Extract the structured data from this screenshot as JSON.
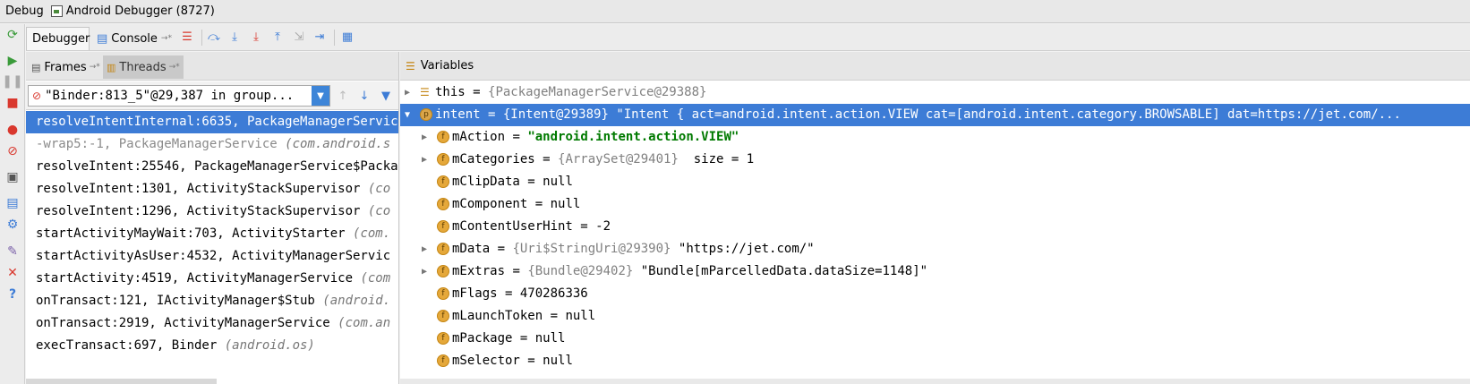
{
  "titlebar": {
    "label": "Debug",
    "session": "Android Debugger (8727)"
  },
  "tabs": {
    "debugger": "Debugger",
    "console": "Console",
    "console_pin": "→*"
  },
  "frames_panel": {
    "frames_tab": "Frames",
    "frames_pin": "→*",
    "threads_tab": "Threads",
    "threads_pin": "→*",
    "thread_selected": "\"Binder:813_5\"@29,387 in group...",
    "frames": [
      {
        "method": "resolveIntentInternal:6635, PackageManagerServic",
        "pkg": ""
      },
      {
        "method": "-wrap5:-1, PackageManagerService ",
        "pkg": "(com.android.s"
      },
      {
        "method": "resolveIntent:25546, PackageManagerService$Packa",
        "pkg": ""
      },
      {
        "method": "resolveIntent:1301, ActivityStackSupervisor ",
        "pkg": "(co"
      },
      {
        "method": "resolveIntent:1296, ActivityStackSupervisor ",
        "pkg": "(co"
      },
      {
        "method": "startActivityMayWait:703, ActivityStarter ",
        "pkg": "(com."
      },
      {
        "method": "startActivityAsUser:4532, ActivityManagerServic",
        "pkg": ""
      },
      {
        "method": "startActivity:4519, ActivityManagerService ",
        "pkg": "(com"
      },
      {
        "method": "onTransact:121, IActivityManager$Stub ",
        "pkg": "(android."
      },
      {
        "method": "onTransact:2919, ActivityManagerService ",
        "pkg": "(com.an"
      },
      {
        "method": "execTransact:697, Binder ",
        "pkg": "(android.os)"
      }
    ]
  },
  "variables_panel": {
    "title": "Variables",
    "rows": [
      {
        "name": "this",
        "eq": " = ",
        "ref": "{PackageManagerService@29388}",
        "val": ""
      },
      {
        "name": "intent",
        "eq": " = ",
        "ref": "{Intent@29389}",
        "val": " \"Intent { act=android.intent.action.VIEW cat=[android.intent.category.BROWSABLE] dat=https://jet.com/..."
      },
      {
        "name": "mAction",
        "eq": " = ",
        "ref": "",
        "val": "\"android.intent.action.VIEW\""
      },
      {
        "name": "mCategories",
        "eq": " = ",
        "ref": "{ArraySet@29401}",
        "val": "  size = 1"
      },
      {
        "name": "mClipData",
        "eq": " = ",
        "ref": "",
        "val": "null"
      },
      {
        "name": "mComponent",
        "eq": " = ",
        "ref": "",
        "val": "null"
      },
      {
        "name": "mContentUserHint",
        "eq": " = ",
        "ref": "",
        "val": "-2"
      },
      {
        "name": "mData",
        "eq": " = ",
        "ref": "{Uri$StringUri@29390}",
        "val": " \"https://jet.com/\""
      },
      {
        "name": "mExtras",
        "eq": " = ",
        "ref": "{Bundle@29402}",
        "val": " \"Bundle[mParcelledData.dataSize=1148]\""
      },
      {
        "name": "mFlags",
        "eq": " = ",
        "ref": "",
        "val": "470286336"
      },
      {
        "name": "mLaunchToken",
        "eq": " = ",
        "ref": "",
        "val": "null"
      },
      {
        "name": "mPackage",
        "eq": " = ",
        "ref": "",
        "val": "null"
      },
      {
        "name": "mSelector",
        "eq": " = ",
        "ref": "",
        "val": "null"
      }
    ]
  },
  "icons": {
    "field_badge": "f",
    "param_badge": "p"
  },
  "colors": {
    "selection": "#3d7cd6",
    "string_value": "#007a00",
    "field_icon": "#e5a83a"
  }
}
